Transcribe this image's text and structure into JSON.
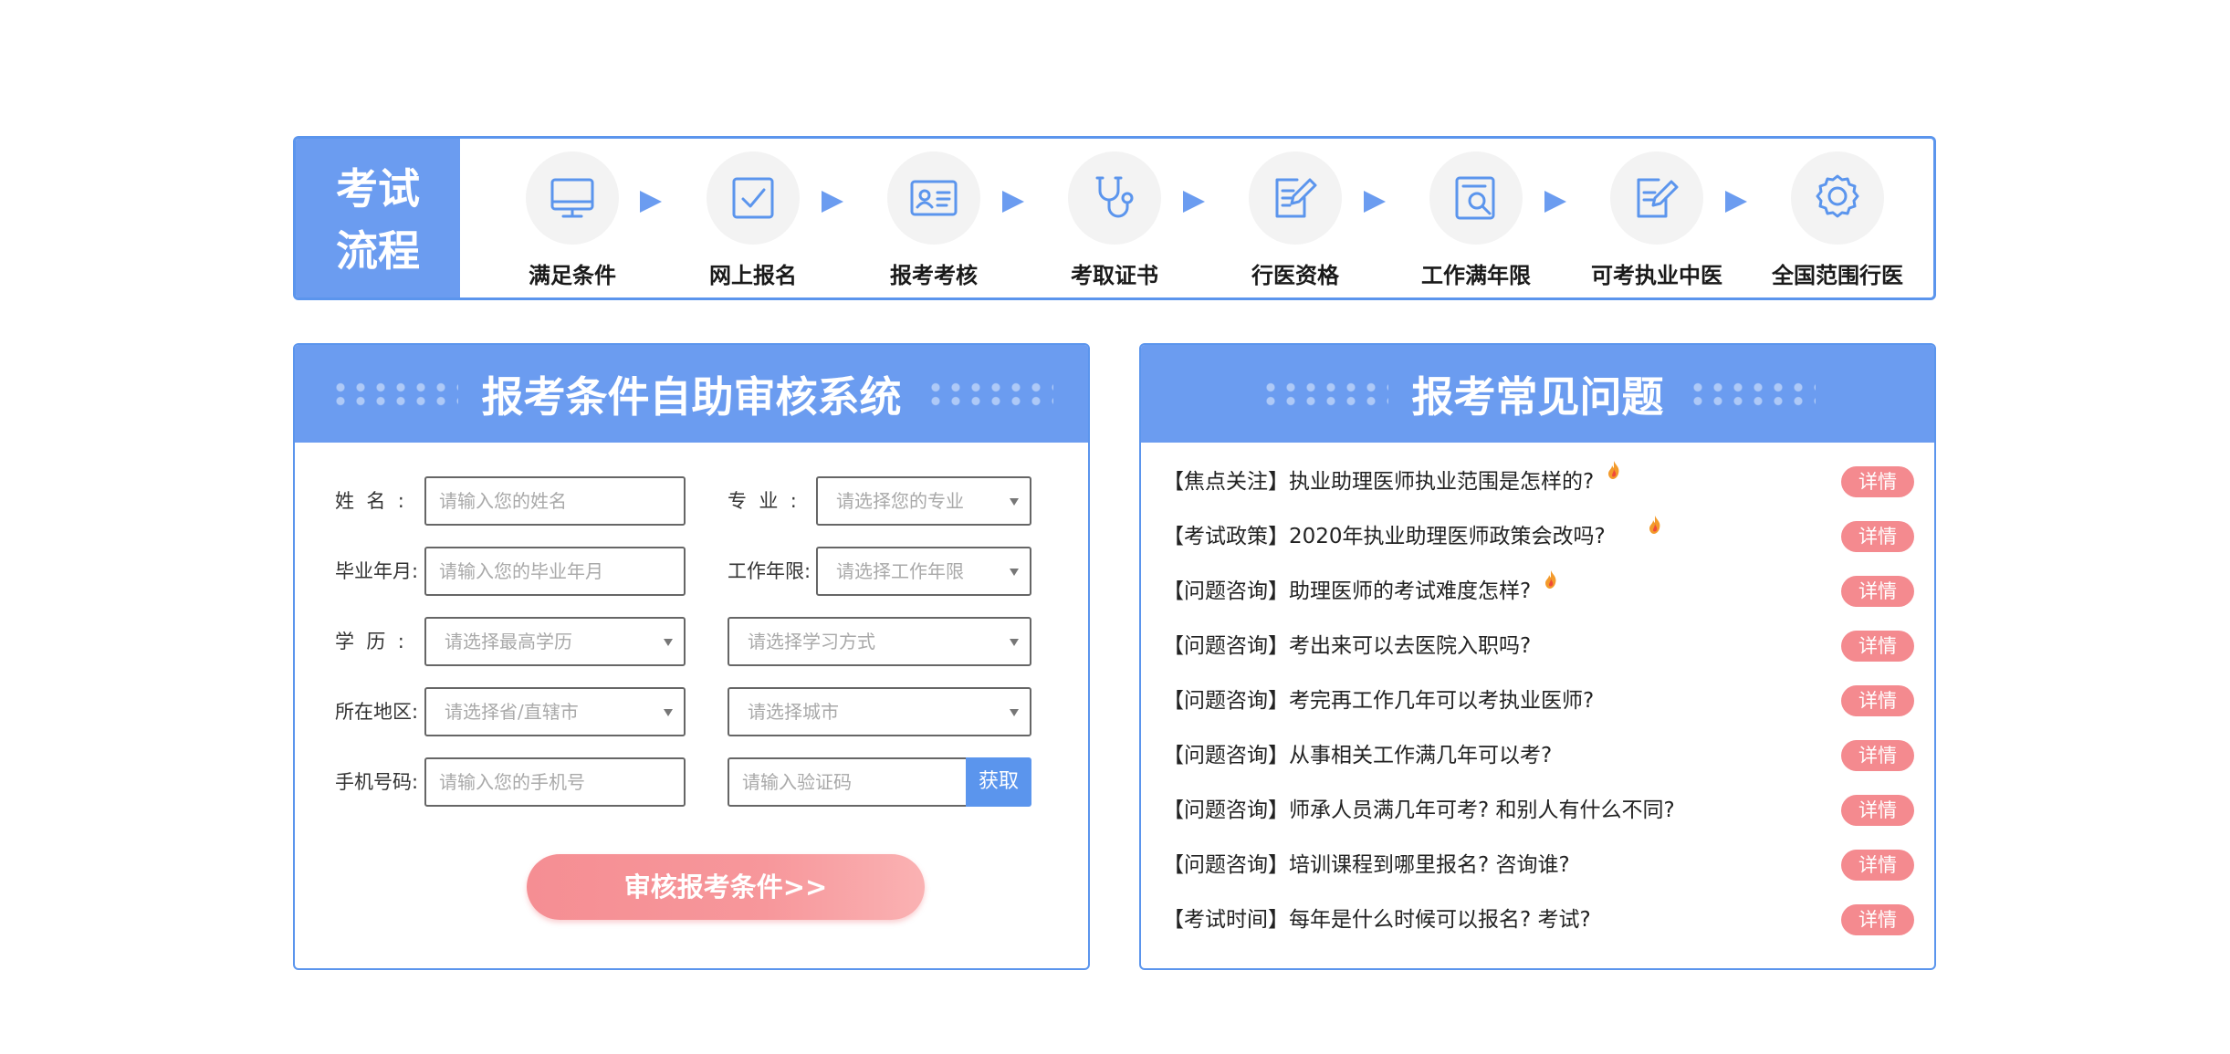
{
  "process": {
    "title_line1": "考试",
    "title_line2": "流程",
    "steps": [
      {
        "label": "满足条件",
        "icon": "monitor-icon"
      },
      {
        "label": "网上报名",
        "icon": "checkbox-icon"
      },
      {
        "label": "报考考核",
        "icon": "id-card-icon"
      },
      {
        "label": "考取证书",
        "icon": "stethoscope-icon"
      },
      {
        "label": "行医资格",
        "icon": "edit-document-icon"
      },
      {
        "label": "工作满年限",
        "icon": "search-document-icon"
      },
      {
        "label": "可考执业中医",
        "icon": "edit-form-icon"
      },
      {
        "label": "全国范围行医",
        "icon": "badge-icon"
      }
    ]
  },
  "form": {
    "title": "报考条件自助审核系统",
    "name_label": "姓  名  :",
    "name_placeholder": "请输入您的姓名",
    "major_label": "专  业  :",
    "major_placeholder": "请选择您的专业",
    "grad_label": "毕业年月:",
    "grad_placeholder": "请输入您的毕业年月",
    "work_label": "工作年限:",
    "work_placeholder": "请选择工作年限",
    "edu_label": "学  历  :",
    "edu_placeholder": "请选择最高学历",
    "study_placeholder": "请选择学习方式",
    "region_label": "所在地区:",
    "province_placeholder": "请选择省/直辖市",
    "city_placeholder": "请选择城市",
    "phone_label": "手机号码:",
    "phone_placeholder": "请输入您的手机号",
    "code_placeholder": "请输入验证码",
    "get_code_label": "获取",
    "submit_label": "审核报考条件>>"
  },
  "faq": {
    "title": "报考常见问题",
    "detail_label": "详情",
    "items": [
      {
        "text": "【焦点关注】执业助理医师执业范围是怎样的?",
        "hot": true
      },
      {
        "text": "【考试政策】2020年执业助理医师政策会改吗?",
        "hot": true
      },
      {
        "text": "【问题咨询】助理医师的考试难度怎样?",
        "hot": true
      },
      {
        "text": "【问题咨询】考出来可以去医院入职吗?",
        "hot": false
      },
      {
        "text": "【问题咨询】考完再工作几年可以考执业医师?",
        "hot": false
      },
      {
        "text": "【问题咨询】从事相关工作满几年可以考?",
        "hot": false
      },
      {
        "text": "【问题咨询】师承人员满几年可考? 和别人有什么不同?",
        "hot": false
      },
      {
        "text": "【问题咨询】培训课程到哪里报名? 咨询谁?",
        "hot": false
      },
      {
        "text": "【考试时间】每年是什么时候可以报名? 考试?",
        "hot": false
      }
    ]
  },
  "colors": {
    "primary": "#6b9cf0",
    "border": "#5b95ed",
    "accent": "#f48a8f"
  }
}
